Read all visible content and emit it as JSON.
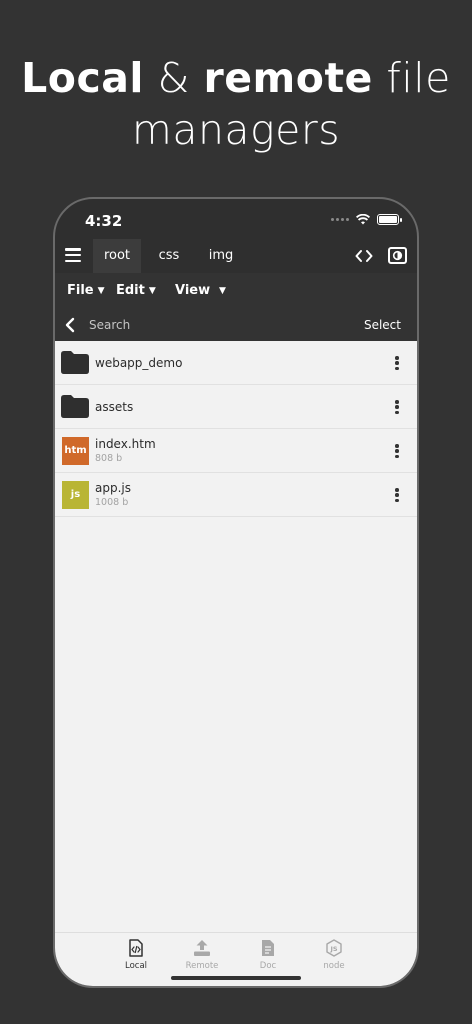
{
  "headline": {
    "bold_1": "Local",
    "amp": " & ",
    "bold_2": "remote",
    "rest_1": " file",
    "line_2": "managers"
  },
  "status_bar": {
    "time": "4:32"
  },
  "tabs": [
    {
      "label": "root",
      "active": true
    },
    {
      "label": "css",
      "active": false
    },
    {
      "label": "img",
      "active": false
    }
  ],
  "menu": {
    "file": "File",
    "edit": "Edit",
    "view": "View",
    "caret": "▼"
  },
  "search": {
    "placeholder": "Search",
    "select_label": "Select"
  },
  "files": [
    {
      "name": "webapp_demo",
      "type": "folder",
      "icon": "folder-icon"
    },
    {
      "name": "assets",
      "type": "folder",
      "icon": "folder-icon"
    },
    {
      "name": "index.htm",
      "type": "file",
      "badge": "htm",
      "size": "808 b"
    },
    {
      "name": "app.js",
      "type": "file",
      "badge": "js",
      "size": "1008 b"
    }
  ],
  "bottom_nav": [
    {
      "label": "Local",
      "icon": "code-file-icon",
      "active": true
    },
    {
      "label": "Remote",
      "icon": "upload-icon",
      "active": false
    },
    {
      "label": "Doc",
      "icon": "document-icon",
      "active": false
    },
    {
      "label": "node",
      "icon": "nodejs-icon",
      "active": false
    }
  ],
  "colors": {
    "background": "#333333",
    "list_bg": "#f2f2f2",
    "htm_badge": "#d0692a",
    "js_badge": "#b9b534",
    "inactive_nav": "#a8a8a8"
  }
}
